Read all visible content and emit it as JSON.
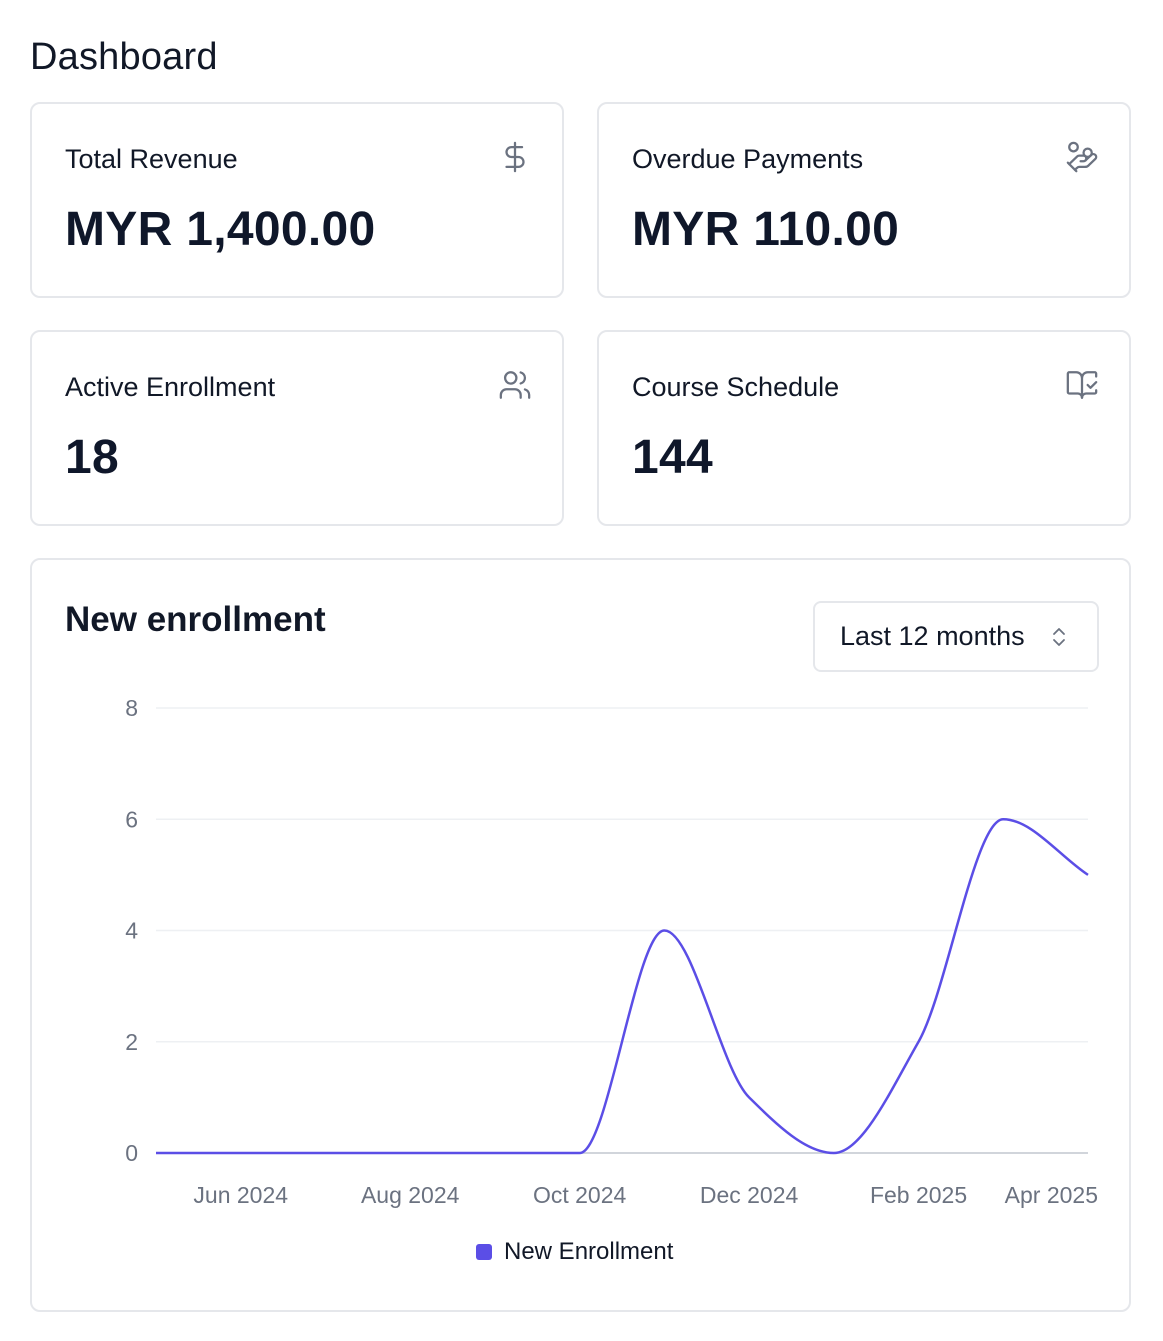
{
  "page": {
    "title": "Dashboard"
  },
  "stats": [
    {
      "label": "Total Revenue",
      "value": "MYR 1,400.00",
      "icon": "dollar-icon"
    },
    {
      "label": "Overdue Payments",
      "value": "MYR 110.00",
      "icon": "hand-coins-icon"
    },
    {
      "label": "Active Enrollment",
      "value": "18",
      "icon": "users-icon"
    },
    {
      "label": "Course Schedule",
      "value": "144",
      "icon": "book-check-icon"
    }
  ],
  "chart": {
    "title": "New enrollment",
    "range_select": {
      "value": "Last 12 months"
    },
    "legend_label": "New Enrollment",
    "color": "#5b4ee6"
  },
  "chart_data": {
    "type": "line",
    "x": [
      "2024-05",
      "2024-06",
      "2024-07",
      "2024-08",
      "2024-09",
      "2024-10",
      "2024-11",
      "2024-12",
      "2025-01",
      "2025-02",
      "2025-03",
      "2025-04"
    ],
    "x_tick_labels": [
      "Jun 2024",
      "Aug 2024",
      "Oct 2024",
      "Dec 2024",
      "Feb 2025",
      "Apr 2025"
    ],
    "y_tick_labels": [
      "0",
      "2",
      "4",
      "6",
      "8"
    ],
    "series": [
      {
        "name": "New Enrollment",
        "values": [
          0,
          0,
          0,
          0,
          0,
          0,
          4,
          1,
          0,
          2,
          6,
          5
        ]
      }
    ],
    "ylim": [
      0,
      8
    ],
    "grid": true,
    "legend": "bottom-center",
    "title": "New enrollment"
  }
}
